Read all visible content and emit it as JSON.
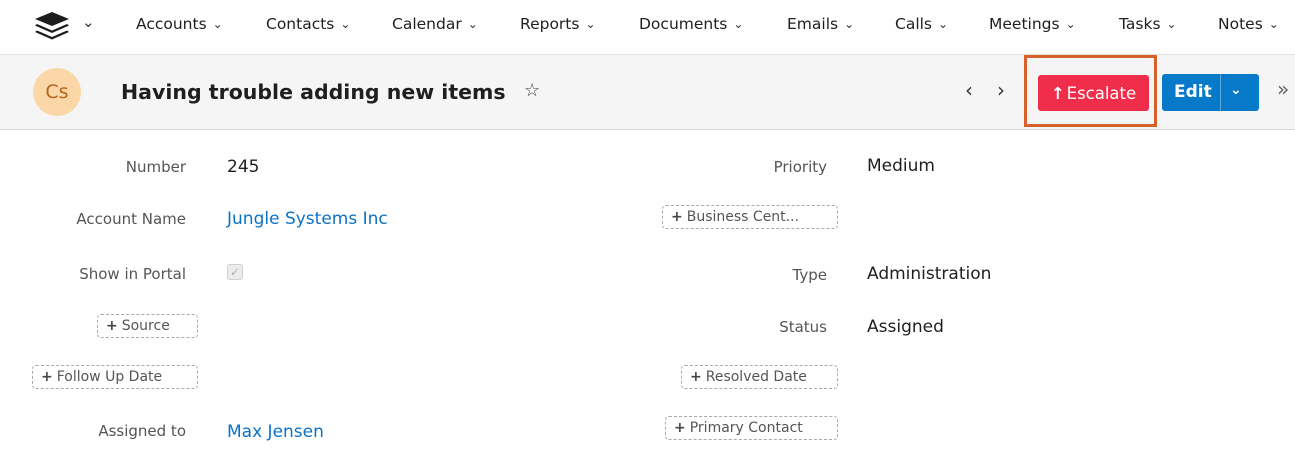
{
  "nav": {
    "logo_icon": "stack-layers-icon",
    "items": [
      {
        "label": "Accounts"
      },
      {
        "label": "Contacts"
      },
      {
        "label": "Calendar"
      },
      {
        "label": "Reports"
      },
      {
        "label": "Documents"
      },
      {
        "label": "Emails"
      },
      {
        "label": "Calls"
      },
      {
        "label": "Meetings"
      },
      {
        "label": "Tasks"
      },
      {
        "label": "Notes"
      }
    ]
  },
  "record": {
    "avatar_initials": "Cs",
    "title": "Having trouble adding new items",
    "favorite_icon": "star-outline-icon",
    "escalate_label": "Escalate",
    "edit_label": "Edit",
    "accent_escalate": "#f02d4a",
    "accent_edit": "#0679c8",
    "highlight_color": "#d4622a"
  },
  "fields": {
    "number": {
      "label": "Number",
      "value": "245"
    },
    "account_name": {
      "label": "Account Name",
      "value": "Jungle Systems Inc"
    },
    "show_in_portal": {
      "label": "Show in Portal",
      "checked": true
    },
    "source_add": "Source",
    "follow_up_add": "Follow Up Date",
    "assigned_to": {
      "label": "Assigned to",
      "value": "Max Jensen"
    },
    "priority": {
      "label": "Priority",
      "value": "Medium"
    },
    "business_center_add": "Business Cent...",
    "type": {
      "label": "Type",
      "value": "Administration"
    },
    "status": {
      "label": "Status",
      "value": "Assigned"
    },
    "resolved_date_add": "Resolved Date",
    "primary_contact_add": "Primary Contact"
  }
}
